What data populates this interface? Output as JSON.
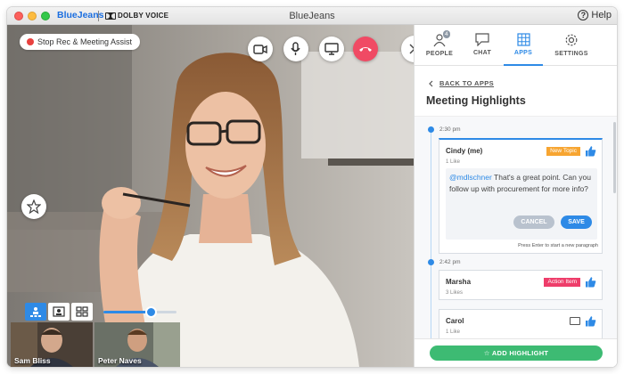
{
  "window": {
    "brand": "BlueJeans",
    "partner": "DOLBY VOICE",
    "title": "BlueJeans",
    "help_label": "Help",
    "help_glyph": "?"
  },
  "video": {
    "stop_rec_label": "Stop Rec & Meeting Assist",
    "controls": [
      "camera-icon",
      "microphone-icon",
      "screen-share-icon",
      "end-call-icon",
      "close-icon"
    ],
    "volume_fraction": 0.65,
    "participants": [
      {
        "name": "Sam Bliss"
      },
      {
        "name": "Peter Naves"
      }
    ]
  },
  "panel": {
    "tabs": [
      {
        "label": "PEOPLE",
        "icon": "people-icon",
        "badge": "4"
      },
      {
        "label": "CHAT",
        "icon": "chat-icon"
      },
      {
        "label": "APPS",
        "icon": "apps-icon",
        "active": true
      },
      {
        "label": "SETTINGS",
        "icon": "gear-icon"
      }
    ],
    "back_label": "BACK TO APPS",
    "title": "Meeting Highlights",
    "highlights": [
      {
        "time": "2:30 pm",
        "name": "Cindy (me)",
        "likes": "1 Like",
        "tag": "New Topic",
        "comment_mention": "@mdlschner",
        "comment_text": " That's a great point. Can you follow up with procurement for more info?",
        "cancel_label": "CANCEL",
        "save_label": "SAVE",
        "hint": "Press Enter to start a new paragraph"
      },
      {
        "time": "2:42 pm",
        "name": "Marsha",
        "likes": "3 Likes",
        "tag": "Action Item"
      },
      {
        "name": "Carol",
        "likes": "1 Like"
      }
    ],
    "add_label": "ADD HIGHLIGHT"
  },
  "colors": {
    "accent": "#2e8ae6",
    "end_call": "#f04a64",
    "add_highlight": "#3dbb73",
    "new_topic": "#f7a531",
    "action_item": "#ee3d6a"
  }
}
